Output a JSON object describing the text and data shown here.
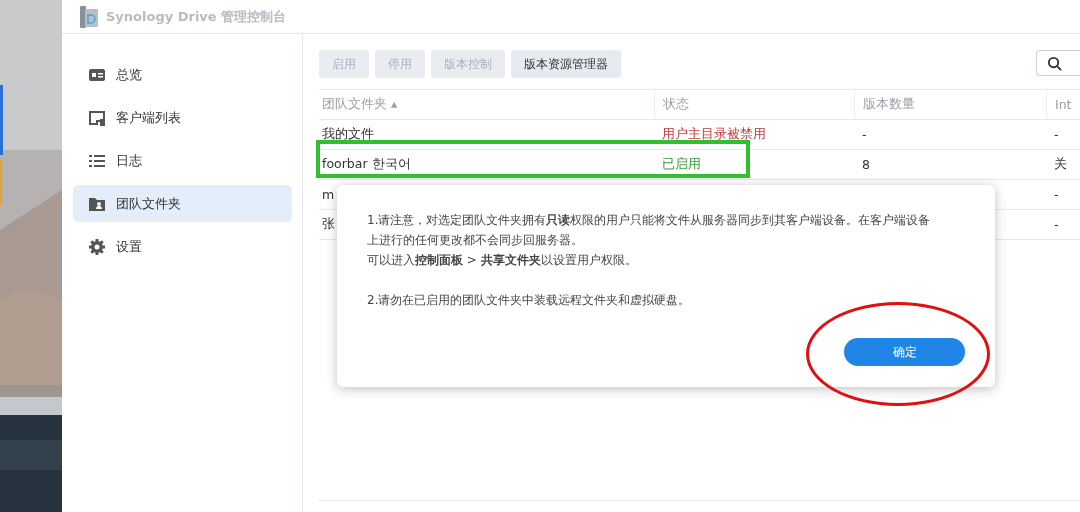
{
  "window": {
    "title": "Synology Drive 管理控制台"
  },
  "sidebar": {
    "items": [
      {
        "label": "总览",
        "selected": false
      },
      {
        "label": "客户端列表",
        "selected": false
      },
      {
        "label": "日志",
        "selected": false
      },
      {
        "label": "团队文件夹",
        "selected": true
      },
      {
        "label": "设置",
        "selected": false
      }
    ]
  },
  "toolbar": {
    "buttons": [
      {
        "label": "启用",
        "disabled": true
      },
      {
        "label": "停用",
        "disabled": true
      },
      {
        "label": "版本控制",
        "disabled": true
      },
      {
        "label": "版本资源管理器",
        "disabled": false
      }
    ]
  },
  "table": {
    "columns": [
      {
        "label": "团队文件夹 ▴"
      },
      {
        "label": "状态"
      },
      {
        "label": "版本数量"
      },
      {
        "label": "Int"
      }
    ],
    "rows": [
      {
        "cells": [
          "我的文件",
          "用户主目录被禁用",
          "-",
          "-"
        ],
        "kind": "error"
      },
      {
        "cells": [
          "foorbar 한국어",
          "已启用",
          "8",
          "关"
        ],
        "kind": "ok"
      },
      {
        "cells": [
          "m",
          "",
          "",
          "-"
        ]
      },
      {
        "cells": [
          "张",
          "",
          "",
          "-"
        ]
      }
    ]
  },
  "dialog": {
    "paragraphs": [
      "1.请注意，对选定团队文件夹拥有**只读**权限的用户只能将文件从服务器同步到其客户端设备。在客户端设备上进行的任何更改都不会同步回服务器。",
      "可以进入**控制面板** > **共享文件夹**以设置用户权限。",
      "2.请勿在已启用的团队文件夹中装载远程文件夹和虚拟硬盘。"
    ],
    "button": "确定"
  },
  "annotations": [
    {
      "kind": "rectangle",
      "color": "#2fbf2f"
    },
    {
      "kind": "ellipse",
      "color": "#e01010"
    }
  ]
}
